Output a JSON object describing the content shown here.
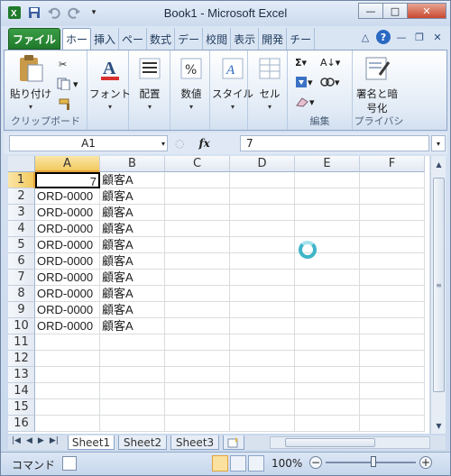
{
  "window": {
    "title": "Book1 - Microsoft Excel"
  },
  "quick_access": {
    "items": [
      "excel-logo",
      "save",
      "undo",
      "redo",
      "customize"
    ]
  },
  "window_controls": {
    "minimize": "—",
    "maximize": "□",
    "close": "✕"
  },
  "ribbon_tabs": {
    "file": "ファイル",
    "tabs": [
      "ホーム",
      "挿入",
      "ページ",
      "数式",
      "データ",
      "校閲",
      "表示",
      "開発",
      "チーム"
    ],
    "tabs_display": [
      "ホー",
      "挿入",
      "ペー",
      "数式",
      "デー",
      "校閲",
      "表示",
      "開発",
      "チー"
    ],
    "active_index": 0
  },
  "ribbon": {
    "clipboard": {
      "paste_label": "貼り付け",
      "group_label": "クリップボード"
    },
    "font": {
      "label": "フォント"
    },
    "alignment": {
      "label": "配置"
    },
    "number": {
      "label": "数値"
    },
    "styles": {
      "label": "スタイル"
    },
    "cells": {
      "label": "セル"
    },
    "editing": {
      "group_label": "編集"
    },
    "privacy": {
      "encrypt_label_line1": "署名と暗",
      "encrypt_label_line2": "号化",
      "group_label": "プライバシ"
    }
  },
  "formula_bar": {
    "name_box": "A1",
    "fx": "fx",
    "content": "7"
  },
  "sheet": {
    "columns": [
      "A",
      "B",
      "C",
      "D",
      "E",
      "F"
    ],
    "selected_column": "A",
    "selected_row": 1,
    "rows": [
      {
        "n": "1",
        "A": "7",
        "B": "顧客A"
      },
      {
        "n": "2",
        "A": "ORD-0000",
        "B": "顧客A"
      },
      {
        "n": "3",
        "A": "ORD-0000",
        "B": "顧客A"
      },
      {
        "n": "4",
        "A": "ORD-0000",
        "B": "顧客A"
      },
      {
        "n": "5",
        "A": "ORD-0000",
        "B": "顧客A"
      },
      {
        "n": "6",
        "A": "ORD-0000",
        "B": "顧客A"
      },
      {
        "n": "7",
        "A": "ORD-0000",
        "B": "顧客A"
      },
      {
        "n": "8",
        "A": "ORD-0000",
        "B": "顧客A"
      },
      {
        "n": "9",
        "A": "ORD-0000",
        "B": "顧客A"
      },
      {
        "n": "10",
        "A": "ORD-0000",
        "B": "顧客A"
      },
      {
        "n": "11",
        "A": "",
        "B": ""
      },
      {
        "n": "12",
        "A": "",
        "B": ""
      },
      {
        "n": "13",
        "A": "",
        "B": ""
      },
      {
        "n": "14",
        "A": "",
        "B": ""
      },
      {
        "n": "15",
        "A": "",
        "B": ""
      },
      {
        "n": "16",
        "A": "",
        "B": ""
      }
    ]
  },
  "sheet_tabs": {
    "tabs": [
      "Sheet1",
      "Sheet2",
      "Sheet3"
    ],
    "active": "Sheet1"
  },
  "status_bar": {
    "mode": "コマンド",
    "zoom": "100%",
    "zoom_minus": "−",
    "zoom_plus": "+"
  },
  "colors": {
    "file_tab": "#1f7a2b",
    "selection_header": "#f2c95e",
    "busy_cursor": "#3fb4c8"
  }
}
